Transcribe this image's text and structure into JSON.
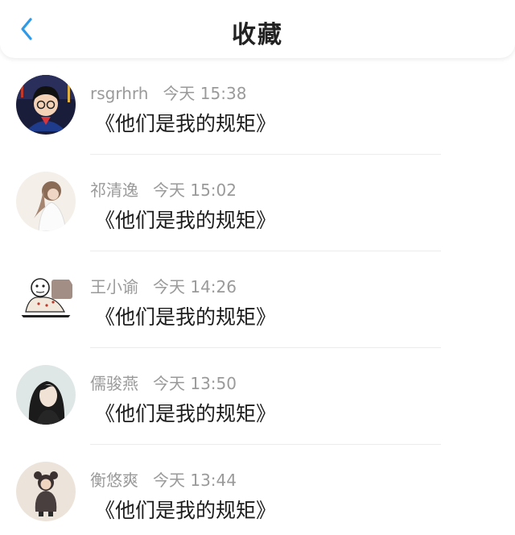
{
  "header": {
    "title": "收藏"
  },
  "items": [
    {
      "name": "rsgrhrh",
      "time": "今天 15:38",
      "title": "《他们是我的规矩》"
    },
    {
      "name": "祁清逸",
      "time": "今天 15:02",
      "title": "《他们是我的规矩》"
    },
    {
      "name": "王小谕",
      "time": "今天 14:26",
      "title": "《他们是我的规矩》"
    },
    {
      "name": "儒骏燕",
      "time": "今天 13:50",
      "title": "《他们是我的规矩》"
    },
    {
      "name": "衡悠爽",
      "time": "今天 13:44",
      "title": "《他们是我的规矩》"
    }
  ],
  "colors": {
    "accent": "#2e9ae8",
    "meta_text": "#9a9a9a",
    "title_text": "#1d1d1d"
  },
  "icons": {
    "back": "chevron-left-icon"
  }
}
